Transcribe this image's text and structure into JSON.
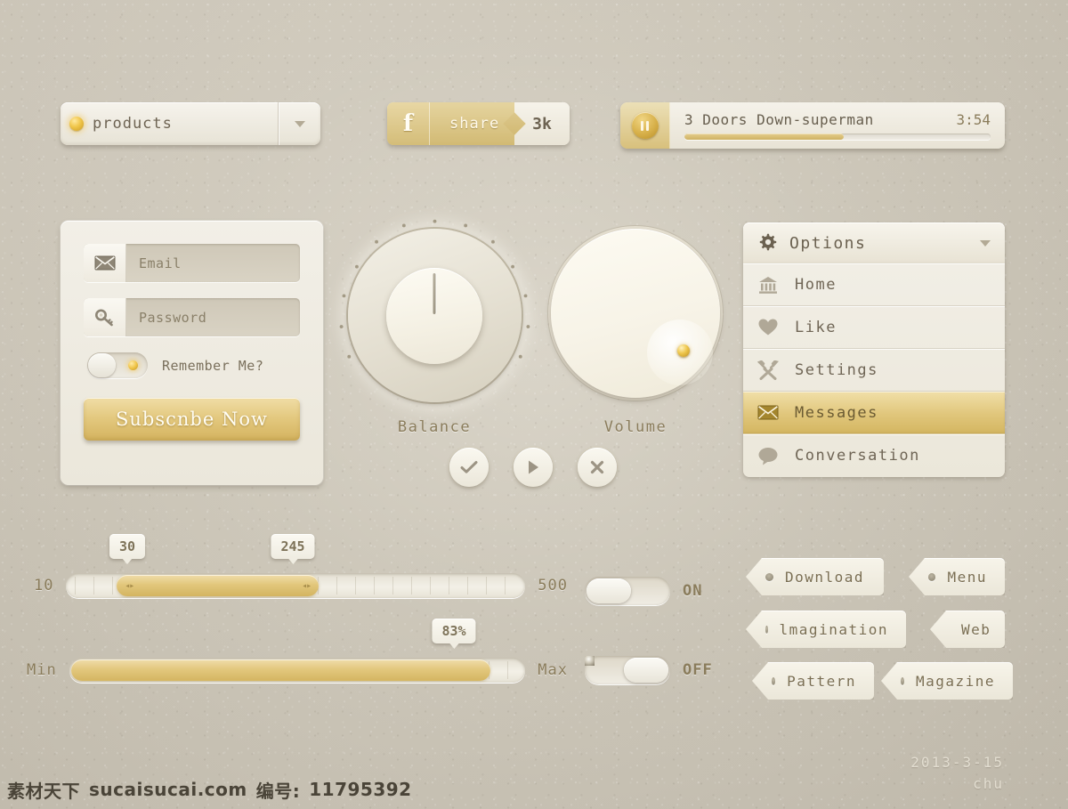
{
  "dropdown": {
    "label": "products",
    "bulb_icon": "bulb-icon",
    "caret_icon": "chevron-down-icon"
  },
  "share": {
    "fb_icon": "facebook-f-icon",
    "label": "share",
    "count": "3k"
  },
  "player": {
    "pause_icon": "pause-icon",
    "title": "3 Doors Down-superman",
    "time": "3:54",
    "progress_percent": 52
  },
  "login": {
    "email": {
      "icon": "envelope-icon",
      "placeholder": "Email",
      "value": ""
    },
    "password": {
      "icon": "key-icon",
      "placeholder": "Password",
      "value": ""
    },
    "remember": {
      "label": "Remember Me?",
      "state": "on"
    },
    "submit_label": "Subscnbe Now"
  },
  "knobs": {
    "balance": {
      "label": "Balance",
      "angle_deg": 0
    },
    "volume": {
      "label": "Volume",
      "angle_deg": 135
    }
  },
  "circle_buttons": [
    {
      "name": "check-button",
      "icon": "check-icon"
    },
    {
      "name": "play-button",
      "icon": "play-icon"
    },
    {
      "name": "close-button",
      "icon": "close-x-icon"
    }
  ],
  "range_slider": {
    "min_label": "10",
    "max_label": "500",
    "low_value": "30",
    "high_value": "245",
    "low_percent": 5,
    "high_percent": 48
  },
  "progress_slider": {
    "min_label": "Min",
    "max_label": "Max",
    "value_label": "83%",
    "percent": 83
  },
  "switches": [
    {
      "name": "switch-on",
      "label": "ON",
      "state": "on"
    },
    {
      "name": "switch-off",
      "label": "OFF",
      "state": "off"
    }
  ],
  "tags": [
    {
      "label": "Download"
    },
    {
      "label": "Menu"
    },
    {
      "label": "lmagination"
    },
    {
      "label": "Web"
    },
    {
      "label": "Pattern"
    },
    {
      "label": "Magazine"
    }
  ],
  "options_menu": {
    "header": {
      "icon": "gear-icon",
      "title": "Options",
      "caret": "chevron-down-icon"
    },
    "items": [
      {
        "label": "Home",
        "icon": "bank-icon",
        "active": false
      },
      {
        "label": "Like",
        "icon": "heart-icon",
        "active": false
      },
      {
        "label": "Settings",
        "icon": "tools-icon",
        "active": false
      },
      {
        "label": "Messages",
        "icon": "envelope-icon",
        "active": true
      },
      {
        "label": "Conversation",
        "icon": "speech-bubble-icon",
        "active": false
      }
    ]
  },
  "signature": {
    "date": "2013-3-15",
    "author": "chu"
  },
  "watermark": {
    "site_cn": "素材天下",
    "site": "sucaisucai.com",
    "id_label": "编号:",
    "id_value": "11795392"
  },
  "colors": {
    "background": "#cdc7ba",
    "gold": "#d9bd70",
    "gold_dark": "#b9942f",
    "panel": "#f0ede4",
    "text": "#6d6352"
  }
}
